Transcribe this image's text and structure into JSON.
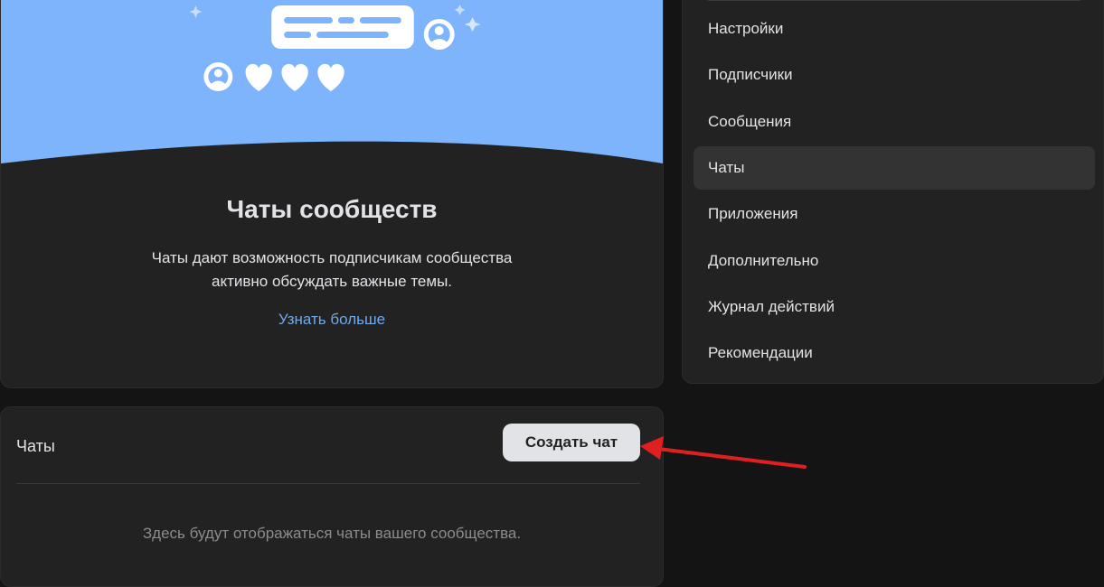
{
  "promo": {
    "title": "Чаты сообществ",
    "description_line1": "Чаты дают возможность подписчикам сообщества",
    "description_line2": "активно обсуждать важные темы.",
    "learn_more": "Узнать больше"
  },
  "chats": {
    "heading": "Чаты",
    "create_button": "Создать чат",
    "empty_text": "Здесь будут отображаться чаты вашего сообщества."
  },
  "menu": {
    "items": [
      {
        "label": "Настройки",
        "active": false
      },
      {
        "label": "Подписчики",
        "active": false
      },
      {
        "label": "Сообщения",
        "active": false
      },
      {
        "label": "Чаты",
        "active": true
      },
      {
        "label": "Приложения",
        "active": false
      },
      {
        "label": "Дополнительно",
        "active": false
      },
      {
        "label": "Журнал действий",
        "active": false
      },
      {
        "label": "Рекомендации",
        "active": false
      }
    ]
  },
  "colors": {
    "background": "#141414",
    "card": "#222222",
    "banner": "#7db4fc",
    "link": "#71aaeb",
    "active_item": "#333333",
    "button_bg": "#e1e3e6",
    "arrow": "#e02020"
  },
  "icons": [
    "user-avatar-icon",
    "heart-icon",
    "sparkle-icon",
    "chat-bubble-icon"
  ]
}
